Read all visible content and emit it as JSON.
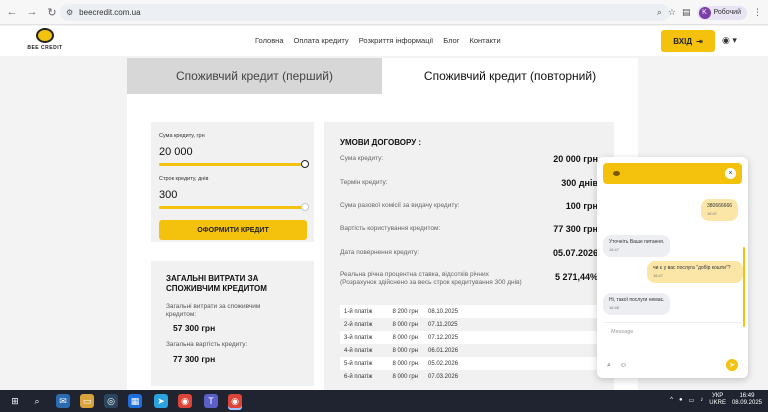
{
  "browser": {
    "url": "beecredit.com.ua",
    "profile_initial": "K",
    "profile_label": "Робочий"
  },
  "header": {
    "logo_text": "BEE CREDIT",
    "menu": [
      "Головна",
      "Оплата кредиту",
      "Розкриття інформації",
      "Блог",
      "Контакти"
    ],
    "login_label": "ВХІД"
  },
  "tabs": {
    "first": "Споживчий кредит (перший)",
    "repeat": "Споживчий кредит (повторний)"
  },
  "calculator": {
    "amount_label": "Сума кредиту, грн",
    "amount_value": "20 000",
    "amount_fraction": 1.0,
    "term_label": "Строк кредиту, днів",
    "term_value": "300",
    "term_fraction": 1.0,
    "apply_label": "ОФОРМИТИ КРЕДИТ"
  },
  "costs": {
    "title": "ЗАГАЛЬНІ ВИТРАТИ ЗА СПОЖИВЧИМ КРЕДИТОМ",
    "total_label": "Загальні витрати за споживчим кредитом:",
    "total_value": "57 300 грн",
    "cost_label": "Загальна вартість кредиту:",
    "cost_value": "77 300 грн"
  },
  "terms": {
    "title": "УМОВИ ДОГОВОРУ :",
    "rows": [
      {
        "label": "Сума кредиту:",
        "value": "20 000 грн"
      },
      {
        "label": "Термін кредиту:",
        "value": "300 днів"
      },
      {
        "label": "Сума разової комісії за видачу кредиту:",
        "value": "100 грн"
      },
      {
        "label": "Вартість користування кредитом:",
        "value": "77 300 грн"
      },
      {
        "label": "Дата повернення кредиту:",
        "value": "05.07.2026"
      }
    ],
    "apr_label": "Реальна річна процентна ставка, відсотків річних",
    "apr_note": "(Розрахунок здійснено за весь строк кредитування 300 днів)",
    "apr_value": "5 271,44%",
    "schedule": [
      {
        "n": "1-й платіж",
        "amount": "8 200 грн",
        "date": "08.10.2025"
      },
      {
        "n": "2-й платіж",
        "amount": "8 000 грн",
        "date": "07.11.2025"
      },
      {
        "n": "3-й платіж",
        "amount": "8 000 грн",
        "date": "07.12.2025"
      },
      {
        "n": "4-й платіж",
        "amount": "8 000 грн",
        "date": "06.01.2026"
      },
      {
        "n": "5-й платіж",
        "amount": "8 000 грн",
        "date": "05.02.2026"
      },
      {
        "n": "6-й платіж",
        "amount": "8 000 грн",
        "date": "07.03.2026"
      }
    ]
  },
  "chat": {
    "messages": [
      {
        "from": "user",
        "text": "380666666",
        "time": "16:47"
      },
      {
        "from": "bot",
        "text": "Уточніть Ваше питання.",
        "time": "16:47"
      },
      {
        "from": "user",
        "text": "чи є у вас послуга \"добір кошти\"?",
        "time": "16:47"
      },
      {
        "from": "bot",
        "text": "Ні, такої послуги немає.",
        "time": "16:48"
      }
    ],
    "input_placeholder": "Message"
  },
  "taskbar": {
    "lang_top": "УКР",
    "lang_bottom": "UKRE",
    "time": "16:49",
    "date": "08.09.2025"
  },
  "colors": {
    "brand_yellow": "#f4c20d",
    "taskbar": "#1f2430"
  }
}
